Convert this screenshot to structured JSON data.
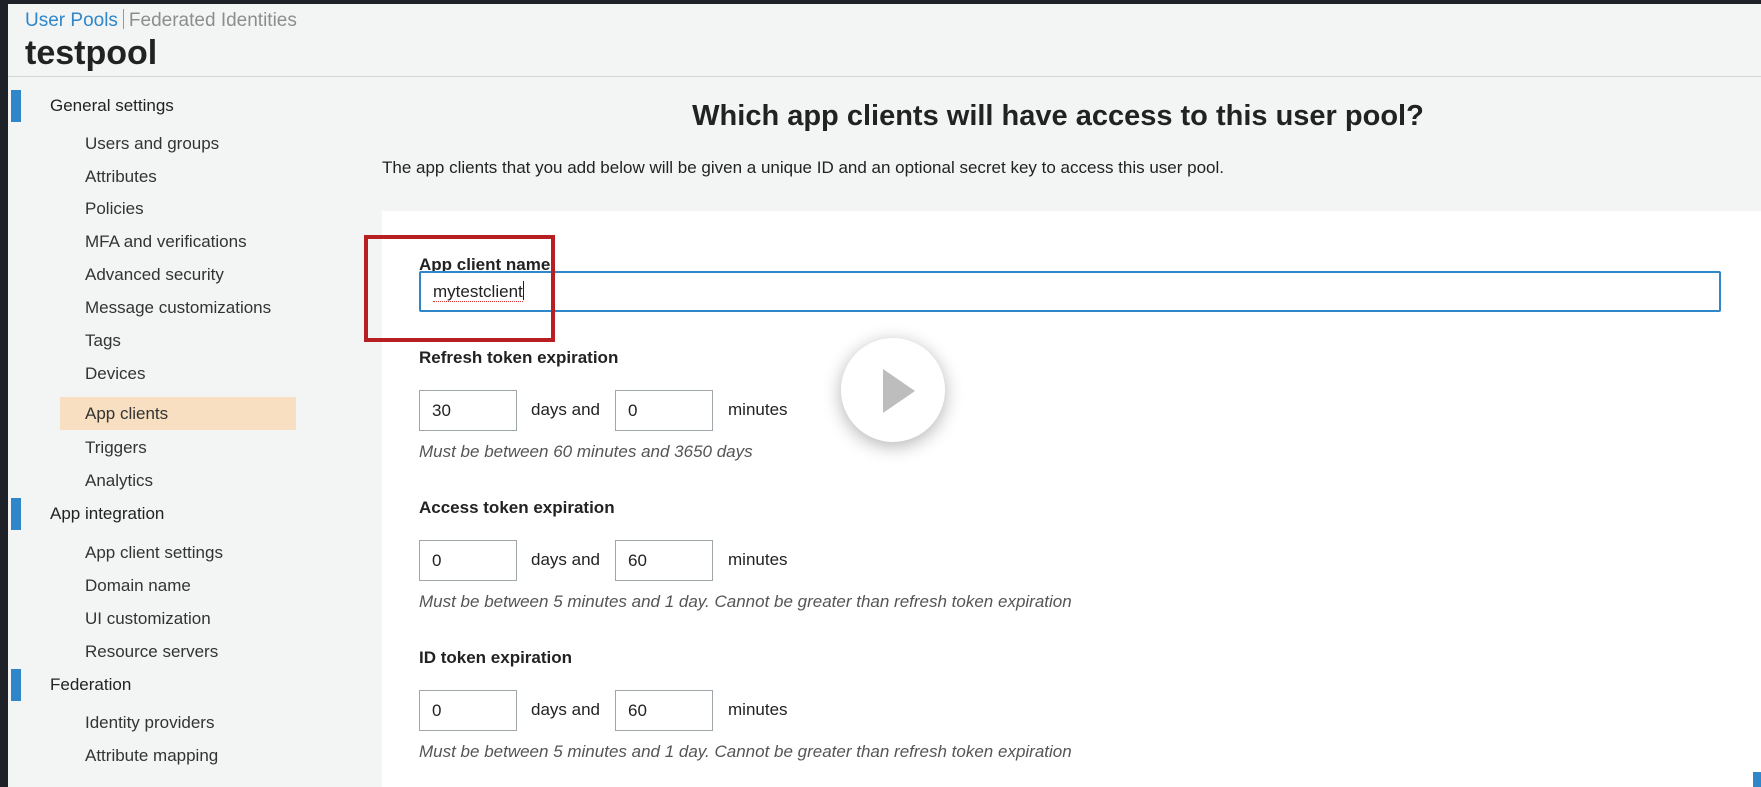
{
  "header": {
    "tabs": [
      {
        "label": "User Pools",
        "active": true
      },
      {
        "label": "Federated Identities",
        "active": false
      }
    ],
    "pool_name": "testpool"
  },
  "sidebar": {
    "sections": [
      {
        "label": "General settings",
        "items": [
          "Users and groups",
          "Attributes",
          "Policies",
          "MFA and verifications",
          "Advanced security",
          "Message customizations",
          "Tags",
          "Devices",
          "App clients",
          "Triggers",
          "Analytics"
        ]
      },
      {
        "label": "App integration",
        "items": [
          "App client settings",
          "Domain name",
          "UI customization",
          "Resource servers"
        ]
      },
      {
        "label": "Federation",
        "items": [
          "Identity providers",
          "Attribute mapping"
        ]
      }
    ],
    "active_item": "App clients"
  },
  "main": {
    "heading": "Which app clients will have access to this user pool?",
    "description": "The app clients that you add below will be given a unique ID and an optional secret key to access this user pool.",
    "app_client_name": {
      "label": "App client name",
      "value": "mytestclient"
    },
    "refresh_token": {
      "label": "Refresh token expiration",
      "days": "30",
      "minutes": "0",
      "days_text": "days and",
      "minutes_text": "minutes",
      "hint": "Must be between 60 minutes and 3650 days"
    },
    "access_token": {
      "label": "Access token expiration",
      "days": "0",
      "minutes": "60",
      "days_text": "days and",
      "minutes_text": "minutes",
      "hint": "Must be between 5 minutes and 1 day. Cannot be greater than refresh token expiration"
    },
    "id_token": {
      "label": "ID token expiration",
      "days": "0",
      "minutes": "60",
      "days_text": "days and",
      "minutes_text": "minutes",
      "hint": "Must be between 5 minutes and 1 day. Cannot be greater than refresh token expiration"
    }
  },
  "overlay": {
    "play_icon": "play-icon",
    "highlight_color": "#b81f22"
  },
  "colors": {
    "accent": "#2f86c8",
    "active_nav_bg": "#f8dfc1",
    "highlight": "#b81f22"
  }
}
